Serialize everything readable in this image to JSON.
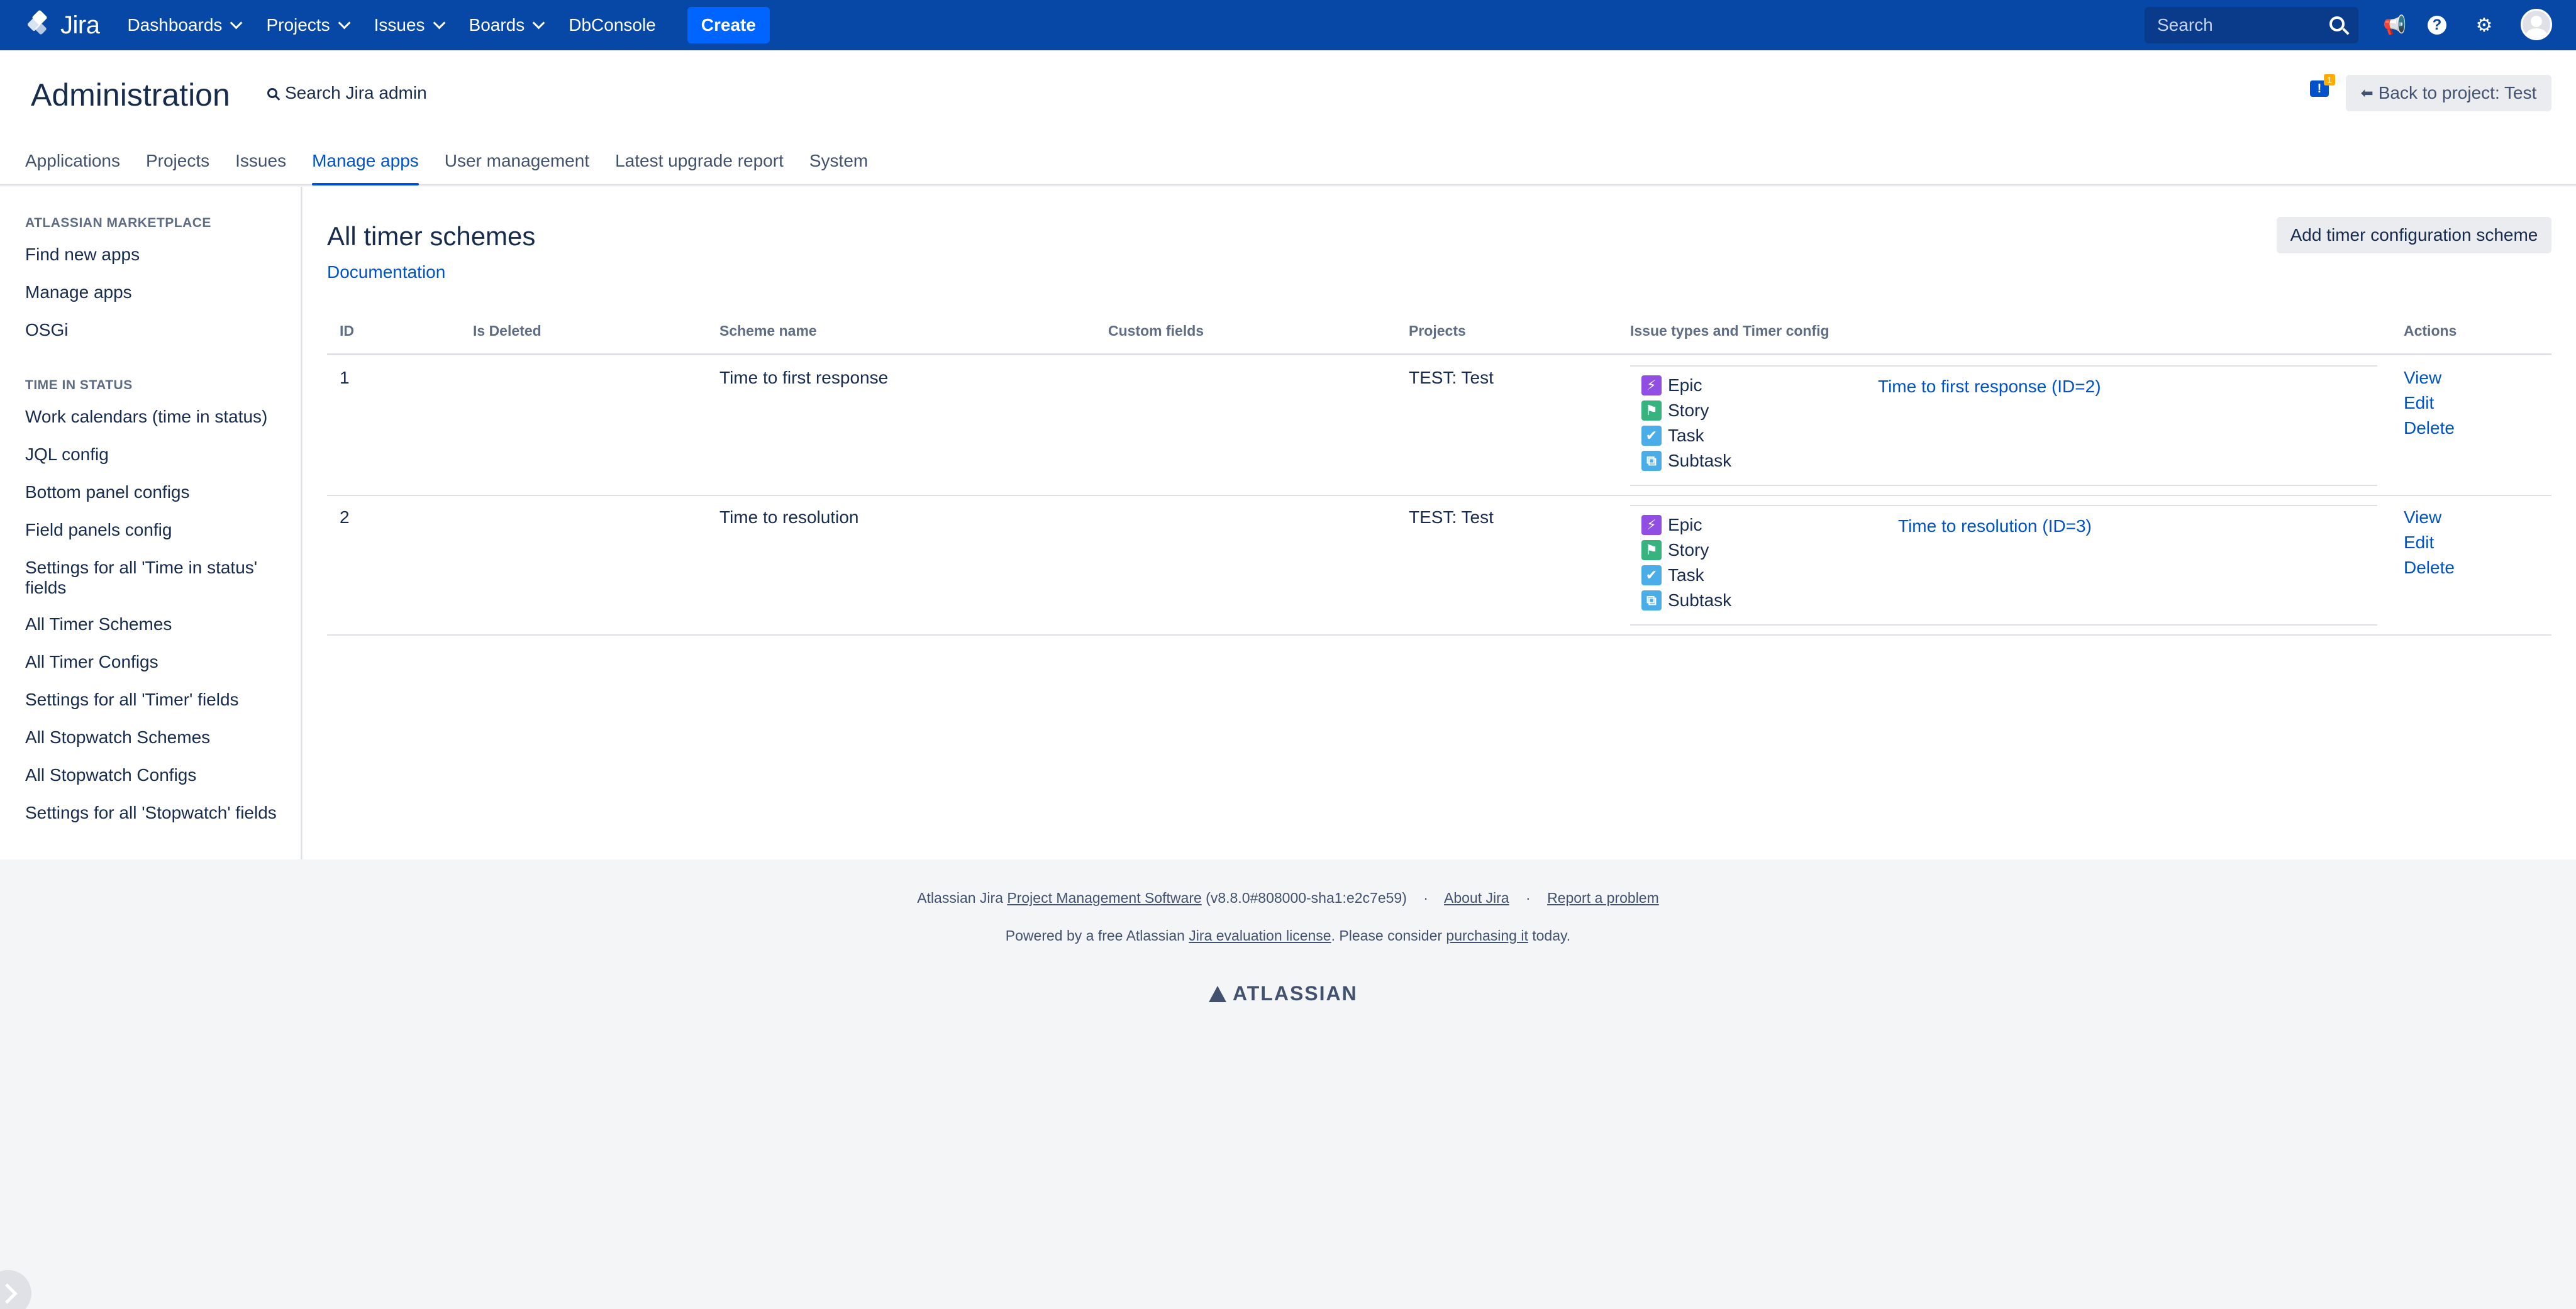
{
  "topnav": {
    "logo_text": "Jira",
    "items": [
      {
        "label": "Dashboards",
        "dropdown": true
      },
      {
        "label": "Projects",
        "dropdown": true
      },
      {
        "label": "Issues",
        "dropdown": true
      },
      {
        "label": "Boards",
        "dropdown": true
      },
      {
        "label": "DbConsole",
        "dropdown": false
      }
    ],
    "create_label": "Create",
    "search_placeholder": "Search",
    "icons": [
      "notifications-icon",
      "help-icon",
      "settings-icon",
      "avatar"
    ]
  },
  "admin": {
    "title": "Administration",
    "search_label": "Search Jira admin",
    "notification_badge": "1",
    "back_label": "Back to project: Test",
    "tabs": [
      "Applications",
      "Projects",
      "Issues",
      "Manage apps",
      "User management",
      "Latest upgrade report",
      "System"
    ],
    "active_tab": "Manage apps"
  },
  "sidebar": {
    "sections": [
      {
        "heading": "ATLASSIAN MARKETPLACE",
        "items": [
          "Find new apps",
          "Manage apps",
          "OSGi"
        ]
      },
      {
        "heading": "TIME IN STATUS",
        "items": [
          "Work calendars (time in status)",
          "JQL config",
          "Bottom panel configs",
          "Field panels config",
          "Settings for all 'Time in status' fields",
          "All Timer Schemes",
          "All Timer Configs",
          "Settings for all 'Timer' fields",
          "All Stopwatch Schemes",
          "All Stopwatch Configs",
          "Settings for all 'Stopwatch' fields"
        ]
      }
    ]
  },
  "main": {
    "title": "All timer schemes",
    "documentation_link": "Documentation",
    "add_button": "Add timer configuration scheme",
    "columns": [
      "ID",
      "Is Deleted",
      "Scheme name",
      "Custom fields",
      "Projects",
      "Issue types and Timer config",
      "Actions"
    ],
    "rows": [
      {
        "id": "1",
        "is_deleted": "",
        "scheme_name": "Time to first response",
        "custom_fields": "",
        "projects": "TEST: Test",
        "issue_types": [
          "Epic",
          "Story",
          "Task",
          "Subtask"
        ],
        "timer_config": "Time to first response (ID=2)",
        "actions": [
          "View",
          "Edit",
          "Delete"
        ]
      },
      {
        "id": "2",
        "is_deleted": "",
        "scheme_name": "Time to resolution",
        "custom_fields": "",
        "projects": "TEST: Test",
        "issue_types": [
          "Epic",
          "Story",
          "Task",
          "Subtask"
        ],
        "timer_config": "Time to resolution (ID=3)",
        "actions": [
          "View",
          "Edit",
          "Delete"
        ]
      }
    ]
  },
  "footer": {
    "line1_prefix": "Atlassian Jira",
    "line1_link": "Project Management Software",
    "line1_version": "(v8.8.0#808000-sha1:e2c7e59)",
    "about_link": "About Jira",
    "report_link": "Report a problem",
    "line2_prefix": "Powered by a free Atlassian",
    "line2_link": "Jira evaluation license",
    "line2_middle": ". Please consider",
    "line2_link2": "purchasing it",
    "line2_suffix": "today.",
    "brand": "ATLASSIAN"
  },
  "colors": {
    "topbar": "#0747a6",
    "link": "#0052cc",
    "create": "#0065ff",
    "epic": "#904ee2",
    "story": "#36b37e",
    "task": "#4bade8"
  }
}
